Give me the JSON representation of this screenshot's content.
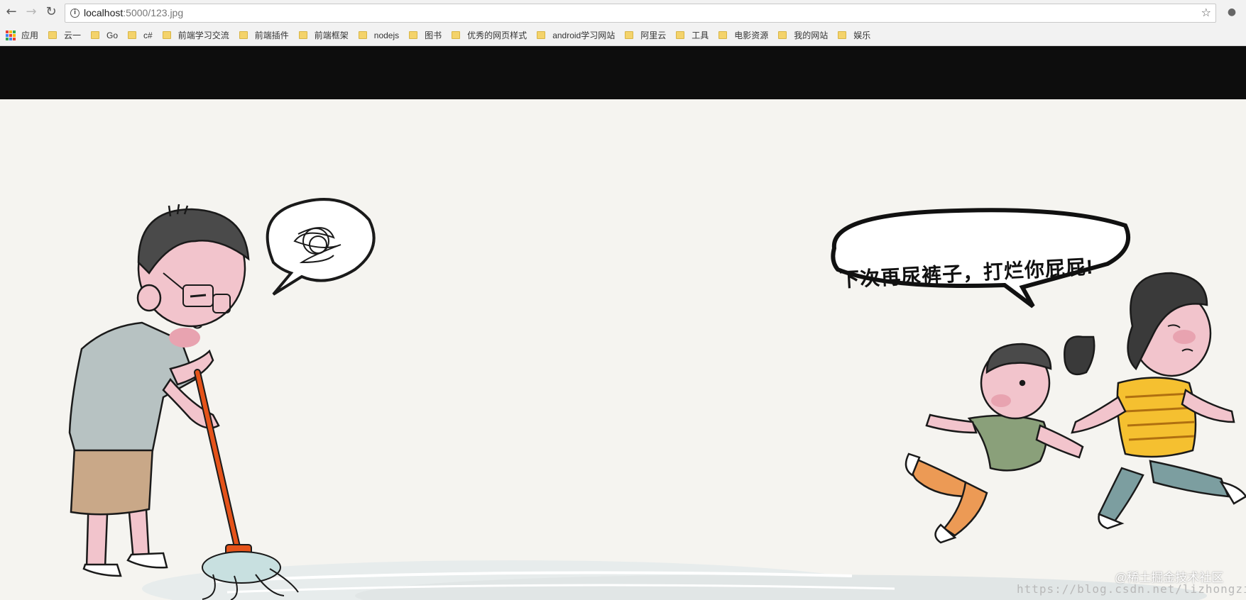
{
  "browser": {
    "url_host": "localhost",
    "url_path": ":5000/123.jpg",
    "nav_icons": [
      "back-arrow-icon",
      "forward-arrow-icon",
      "reload-icon"
    ],
    "bookmark_star_icon": "star-icon"
  },
  "bookmarks": {
    "apps_label": "应用",
    "apps_colors": [
      "#e94235",
      "#fbbc04",
      "#34a853",
      "#4285f4",
      "#e94235",
      "#fbbc04",
      "#34a853",
      "#4285f4",
      "#e94235"
    ],
    "items": [
      {
        "label": "云一"
      },
      {
        "label": "Go"
      },
      {
        "label": "c#"
      },
      {
        "label": "前端学习交流"
      },
      {
        "label": "前端插件"
      },
      {
        "label": "前端框架"
      },
      {
        "label": "nodejs"
      },
      {
        "label": "图书"
      },
      {
        "label": "优秀的网页样式"
      },
      {
        "label": "android学习网站"
      },
      {
        "label": "阿里云"
      },
      {
        "label": "工具"
      },
      {
        "label": "电影资源"
      },
      {
        "label": "我的网站"
      },
      {
        "label": "娱乐"
      }
    ]
  },
  "image": {
    "speech_bubble_text": "下次再尿裤子，打烂你屁屁!",
    "watermark": "@稀土掘金技术社区",
    "url_watermark": "https://blog.csdn.net/lizhongzi"
  },
  "colors": {
    "band": "#0d0d0d",
    "mop_handle": "#e5531a",
    "shirt_gray": "#b7c2c2",
    "shorts_tan": "#c9a888",
    "skin_pink": "#f2c4cc",
    "girl_shirt": "#f5c030",
    "boy_shirt": "#8aa07a",
    "boy_pants": "#ec9a55",
    "girl_pants": "#7c9ea0"
  }
}
